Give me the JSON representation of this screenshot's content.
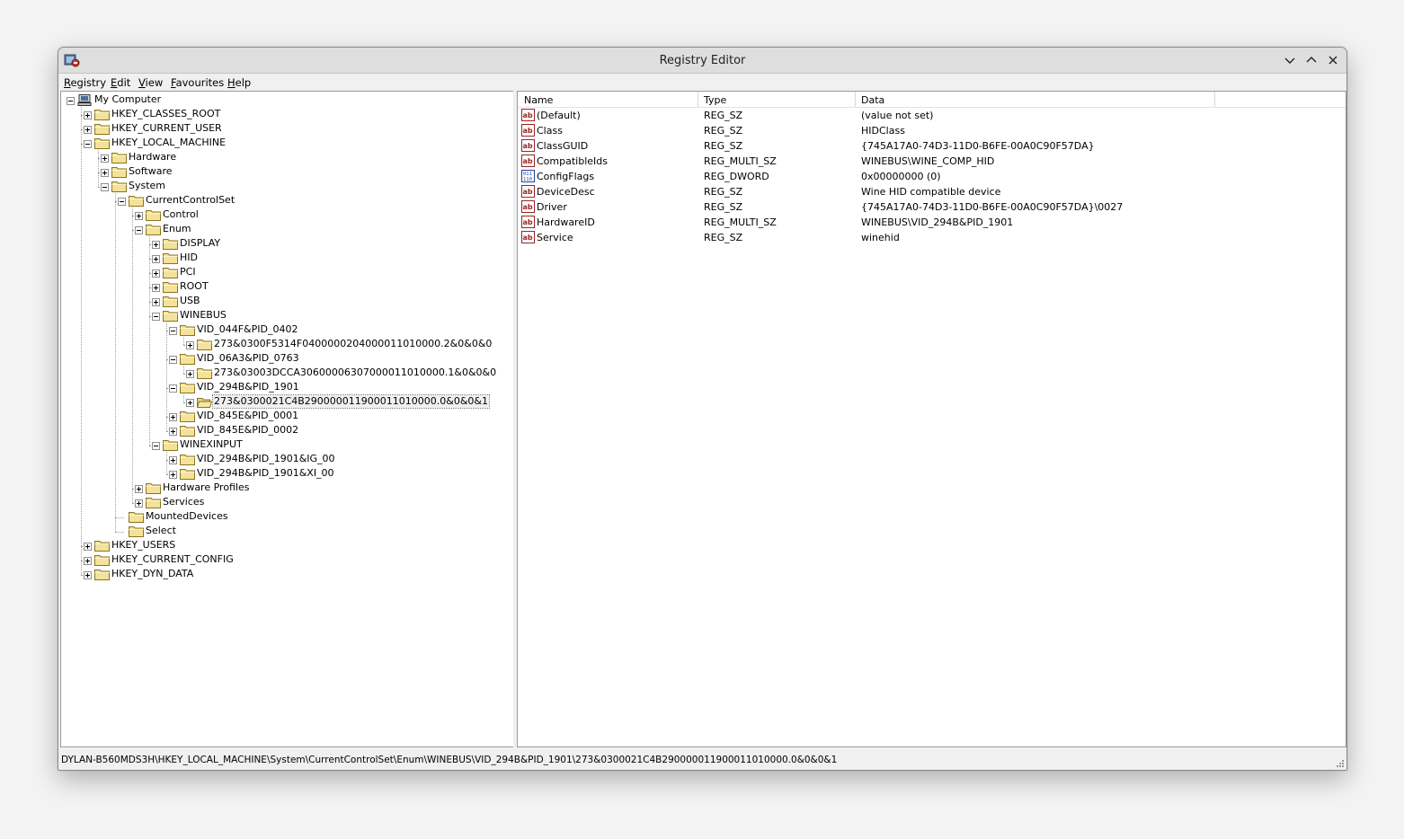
{
  "window": {
    "title": "Registry Editor"
  },
  "titlebar_buttons": {
    "minimize": "minimize",
    "maximize": "maximize",
    "close": "close"
  },
  "menu": [
    {
      "label": "Registry",
      "accel": "R",
      "rest": "egistry"
    },
    {
      "label": "Edit",
      "accel": "E",
      "rest": "dit"
    },
    {
      "label": "View",
      "accel": "V",
      "rest": "iew"
    },
    {
      "label": "Favourites",
      "accel": "F",
      "rest": "avourites"
    },
    {
      "label": "Help",
      "accel": "H",
      "rest": "elp"
    }
  ],
  "tree": [
    {
      "label": "My Computer",
      "depth": 0,
      "expander": "minus",
      "icon": "computer-icon"
    },
    {
      "label": "HKEY_CLASSES_ROOT",
      "depth": 1,
      "expander": "plus",
      "icon": "folder-closed-icon"
    },
    {
      "label": "HKEY_CURRENT_USER",
      "depth": 1,
      "expander": "plus",
      "icon": "folder-closed-icon"
    },
    {
      "label": "HKEY_LOCAL_MACHINE",
      "depth": 1,
      "expander": "minus",
      "icon": "folder-closed-icon"
    },
    {
      "label": "Hardware",
      "depth": 2,
      "expander": "plus",
      "icon": "folder-closed-icon"
    },
    {
      "label": "Software",
      "depth": 2,
      "expander": "plus",
      "icon": "folder-closed-icon"
    },
    {
      "label": "System",
      "depth": 2,
      "expander": "minus",
      "icon": "folder-closed-icon"
    },
    {
      "label": "CurrentControlSet",
      "depth": 3,
      "expander": "minus",
      "icon": "folder-closed-icon"
    },
    {
      "label": "Control",
      "depth": 4,
      "expander": "plus",
      "icon": "folder-closed-icon"
    },
    {
      "label": "Enum",
      "depth": 4,
      "expander": "minus",
      "icon": "folder-closed-icon"
    },
    {
      "label": "DISPLAY",
      "depth": 5,
      "expander": "plus",
      "icon": "folder-closed-icon"
    },
    {
      "label": "HID",
      "depth": 5,
      "expander": "plus",
      "icon": "folder-closed-icon"
    },
    {
      "label": "PCI",
      "depth": 5,
      "expander": "plus",
      "icon": "folder-closed-icon"
    },
    {
      "label": "ROOT",
      "depth": 5,
      "expander": "plus",
      "icon": "folder-closed-icon"
    },
    {
      "label": "USB",
      "depth": 5,
      "expander": "plus",
      "icon": "folder-closed-icon"
    },
    {
      "label": "WINEBUS",
      "depth": 5,
      "expander": "minus",
      "icon": "folder-closed-icon"
    },
    {
      "label": "VID_044F&PID_0402",
      "depth": 6,
      "expander": "minus",
      "icon": "folder-closed-icon"
    },
    {
      "label": "273&0300F5314F0400000204000011010000.2&0&0&0",
      "depth": 7,
      "expander": "plus",
      "icon": "folder-closed-icon"
    },
    {
      "label": "VID_06A3&PID_0763",
      "depth": 6,
      "expander": "minus",
      "icon": "folder-closed-icon"
    },
    {
      "label": "273&03003DCCA30600006307000011010000.1&0&0&0",
      "depth": 7,
      "expander": "plus",
      "icon": "folder-closed-icon"
    },
    {
      "label": "VID_294B&PID_1901",
      "depth": 6,
      "expander": "minus",
      "icon": "folder-closed-icon"
    },
    {
      "label": "273&0300021C4B290000011900011010000.0&0&0&1",
      "depth": 7,
      "expander": "plus",
      "icon": "folder-open-icon",
      "selected": true
    },
    {
      "label": "VID_845E&PID_0001",
      "depth": 6,
      "expander": "plus",
      "icon": "folder-closed-icon"
    },
    {
      "label": "VID_845E&PID_0002",
      "depth": 6,
      "expander": "plus",
      "icon": "folder-closed-icon"
    },
    {
      "label": "WINEXINPUT",
      "depth": 5,
      "expander": "minus",
      "icon": "folder-closed-icon"
    },
    {
      "label": "VID_294B&PID_1901&IG_00",
      "depth": 6,
      "expander": "plus",
      "icon": "folder-closed-icon"
    },
    {
      "label": "VID_294B&PID_1901&XI_00",
      "depth": 6,
      "expander": "plus",
      "icon": "folder-closed-icon"
    },
    {
      "label": "Hardware Profiles",
      "depth": 4,
      "expander": "plus",
      "icon": "folder-closed-icon"
    },
    {
      "label": "Services",
      "depth": 4,
      "expander": "plus",
      "icon": "folder-closed-icon"
    },
    {
      "label": "MountedDevices",
      "depth": 3,
      "expander": "none",
      "icon": "folder-closed-icon"
    },
    {
      "label": "Select",
      "depth": 3,
      "expander": "none",
      "icon": "folder-closed-icon"
    },
    {
      "label": "HKEY_USERS",
      "depth": 1,
      "expander": "plus",
      "icon": "folder-closed-icon"
    },
    {
      "label": "HKEY_CURRENT_CONFIG",
      "depth": 1,
      "expander": "plus",
      "icon": "folder-closed-icon"
    },
    {
      "label": "HKEY_DYN_DATA",
      "depth": 1,
      "expander": "plus",
      "icon": "folder-closed-icon"
    }
  ],
  "list": {
    "columns": [
      "Name",
      "Type",
      "Data"
    ],
    "rows": [
      {
        "name": "(Default)",
        "type": "REG_SZ",
        "data": "(value not set)",
        "icon": "string-value-icon"
      },
      {
        "name": "Class",
        "type": "REG_SZ",
        "data": "HIDClass",
        "icon": "string-value-icon"
      },
      {
        "name": "ClassGUID",
        "type": "REG_SZ",
        "data": "{745A17A0-74D3-11D0-B6FE-00A0C90F57DA}",
        "icon": "string-value-icon"
      },
      {
        "name": "CompatibleIds",
        "type": "REG_MULTI_SZ",
        "data": "WINEBUS\\WINE_COMP_HID",
        "icon": "string-value-icon"
      },
      {
        "name": "ConfigFlags",
        "type": "REG_DWORD",
        "data": "0x00000000 (0)",
        "icon": "binary-value-icon"
      },
      {
        "name": "DeviceDesc",
        "type": "REG_SZ",
        "data": "Wine HID compatible device",
        "icon": "string-value-icon"
      },
      {
        "name": "Driver",
        "type": "REG_SZ",
        "data": "{745A17A0-74D3-11D0-B6FE-00A0C90F57DA}\\0027",
        "icon": "string-value-icon"
      },
      {
        "name": "HardwareID",
        "type": "REG_MULTI_SZ",
        "data": "WINEBUS\\VID_294B&PID_1901",
        "icon": "string-value-icon"
      },
      {
        "name": "Service",
        "type": "REG_SZ",
        "data": "winehid",
        "icon": "string-value-icon"
      }
    ]
  },
  "status": {
    "path": "DYLAN-B560MDS3H\\HKEY_LOCAL_MACHINE\\System\\CurrentControlSet\\Enum\\WINEBUS\\VID_294B&PID_1901\\273&0300021C4B290000011900011010000.0&0&0&1"
  }
}
